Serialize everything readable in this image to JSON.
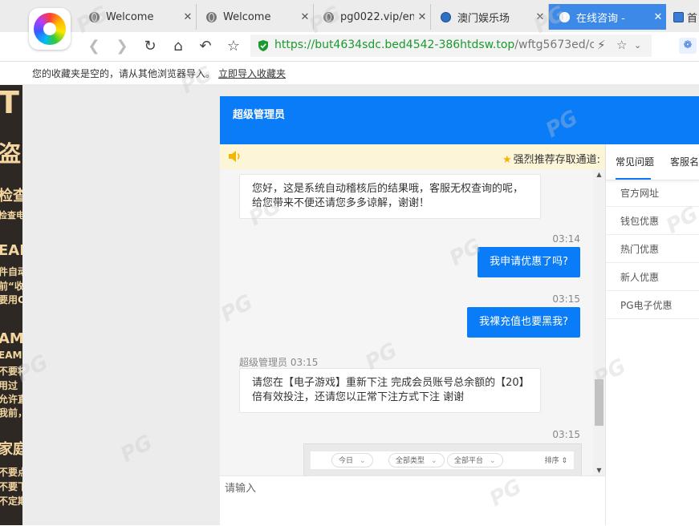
{
  "tabs": [
    {
      "title": "Welcome",
      "icon": "globe-icon",
      "active": false
    },
    {
      "title": "Welcome",
      "icon": "globe-icon",
      "active": false
    },
    {
      "title": "pg0022.vip/en",
      "icon": "globe-icon",
      "active": false
    },
    {
      "title": "澳门娱乐场",
      "icon": "casino-icon",
      "active": false
    },
    {
      "title": "在线咨询 -",
      "icon": "globe-icon",
      "active": true
    },
    {
      "title": "首",
      "icon": "app-icon",
      "active": false
    }
  ],
  "toolbar": {
    "url_scheme": "https://",
    "url_host": "but4634sdc.bed4542-386htdsw.top",
    "url_path": "/wftg5673ed/cha"
  },
  "bookmarks": {
    "empty_text": "您的收藏夹是空的，请从其他浏览器导入。",
    "import_link": "立即导入收藏夹"
  },
  "page_bg_fragments": [
    "T",
    "盗",
    "检查",
    "检查电",
    "EAM",
    "件自动",
    "前“收",
    "要用C",
    "AM",
    "EAM",
    "不要将",
    "用过",
    "允许直",
    "我前，",
    "家庭",
    "不要点",
    "不要下",
    "不定期"
  ],
  "chat": {
    "header_title": "超级管理员",
    "notice_text": "强烈推荐存取通道:",
    "messages": [
      {
        "type": "in",
        "text": "您好，这是系统自动稽核后的结果哦，客服无权查询的呢，给您带来不便还请您多多谅解，谢谢！"
      },
      {
        "type": "time",
        "text": "03:14"
      },
      {
        "type": "out",
        "text": "我申请优惠了吗?"
      },
      {
        "type": "time",
        "text": "03:15"
      },
      {
        "type": "out",
        "text": "我裸充值也要黑我?"
      },
      {
        "type": "sender",
        "text": "超级管理员 03:15"
      },
      {
        "type": "in",
        "text": "请您在【电子游戏】重新下注 完成会员账号总余额的【20】倍有效投注，还请您以正常下注方式下注 谢谢"
      },
      {
        "type": "time",
        "text": "03:15"
      }
    ],
    "image_card": {
      "filters": [
        "今日",
        "全部类型",
        "全部平台"
      ],
      "sort_label": "排序"
    },
    "input_placeholder": "请输入",
    "side_tabs": [
      "常见问题",
      "客服名"
    ],
    "side_items": [
      "官方网址",
      "钱包优惠",
      "热门优惠",
      "新人优惠",
      "PG电子优惠"
    ]
  },
  "watermark_text": "PG"
}
